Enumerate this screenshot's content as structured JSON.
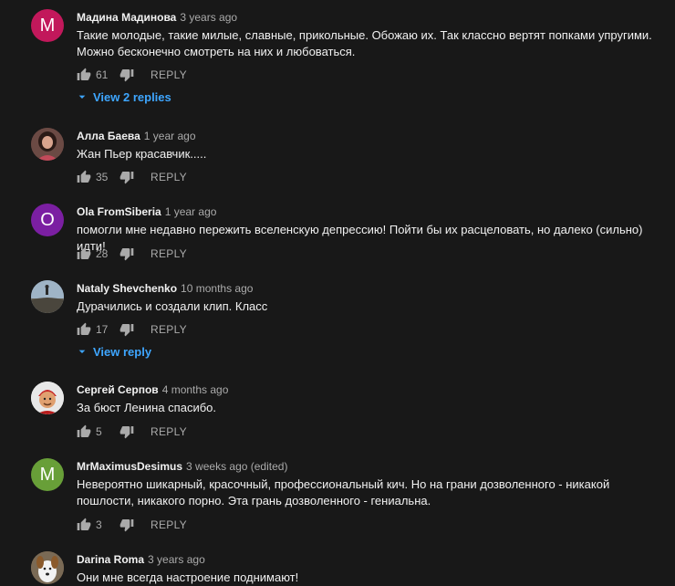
{
  "reply_label": "REPLY",
  "colors": {
    "background": "#181818",
    "text": "#f1f1f1",
    "secondary": "#aaaaaa",
    "link": "#3ea6ff"
  },
  "comments": [
    {
      "author": "Мадина Мадинова",
      "time": "3 years ago",
      "avatar_letter": "M",
      "avatar_color": "#c2185b",
      "text": "Такие молодые, такие милые, славные, прикольные. Обожаю их. Так классно вертят попками упругими. Можно бесконечно смотреть на них и любоваться.",
      "likes": "61",
      "replies": "View 2 replies"
    },
    {
      "author": "Алла Баева",
      "time": "1 year ago",
      "avatar_icon": "user-photo-icon",
      "text": "Жан Пьер красавчик.....",
      "likes": "35"
    },
    {
      "author": "Ola FromSiberia",
      "time": "1 year ago",
      "avatar_letter": "O",
      "avatar_color": "#7b1fa2",
      "text": "помогли мне недавно пережить вселенскую депрессию! Пойти бы их расцеловать, но далеко (сильно) идти!",
      "likes": "28"
    },
    {
      "author": "Nataly Shevchenko",
      "time": "10 months ago",
      "avatar_icon": "landscape-photo-icon",
      "text": "Дурачились и создали клип. Класс",
      "likes": "17",
      "replies": "View reply"
    },
    {
      "author": "Сергей Серпов",
      "time": "4 months ago",
      "avatar_icon": "cartoon-avatar-icon",
      "text": "За бюст Ленина спасибо.",
      "likes": "5"
    },
    {
      "author": "MrMaximusDesimus",
      "time": "3 weeks ago (edited)",
      "avatar_letter": "M",
      "avatar_color": "#689f38",
      "text": "Невероятно шикарный,  красочный, профессиональный кич. Но  на грани  дозволенного - никакой пошлости, никакого порно. Эта грань дозволенного - гениальна.",
      "likes": "3"
    },
    {
      "author": "Darina Roma",
      "time": "3 years ago",
      "avatar_icon": "dog-photo-icon",
      "text": "Они мне всегда настроение поднимают!"
    }
  ]
}
